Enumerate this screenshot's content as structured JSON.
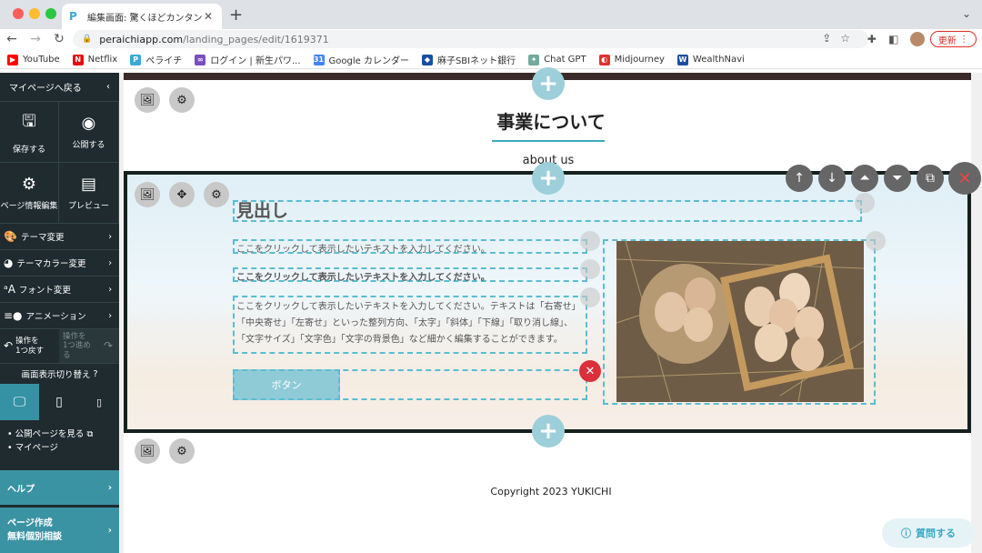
{
  "browser": {
    "tab_title": "編集画面: 驚くほどカンタン！無料",
    "url_host": "peraichiapp.com",
    "url_path": "/landing_pages/edit/1619371",
    "update_label": "更新",
    "bookmarks": [
      {
        "label": "YouTube",
        "color": "#ff0000",
        "glyph": "▶"
      },
      {
        "label": "Netflix",
        "color": "#e50914",
        "glyph": "N"
      },
      {
        "label": "ペライチ",
        "color": "#3aa9d5",
        "glyph": "P"
      },
      {
        "label": "ログイン | 新生パワ...",
        "color": "#7a4fbf",
        "glyph": "∞"
      },
      {
        "label": "Google カレンダー",
        "color": "#4285f4",
        "glyph": "31"
      },
      {
        "label": "麻子SBIネット銀行",
        "color": "#1a4fa0",
        "glyph": "◆"
      },
      {
        "label": "Chat GPT",
        "color": "#74aa9c",
        "glyph": "✦"
      },
      {
        "label": "Midjourney",
        "color": "#d33",
        "glyph": "◐"
      },
      {
        "label": "WealthNavi",
        "color": "#1e4fa2",
        "glyph": "W"
      }
    ]
  },
  "sidebar": {
    "back": "マイページへ戻る",
    "save": "保存する",
    "publish": "公開する",
    "page_info": "ページ情報編集",
    "preview": "プレビュー",
    "theme": "テーマ変更",
    "theme_color": "テーマカラー変更",
    "font": "フォント変更",
    "animation": "アニメーション",
    "undo_line1": "操作を",
    "undo_line2": "1つ戻す",
    "redo_line1": "操作を",
    "redo_line2": "1つ進める",
    "view_switch": "画面表示切り替え",
    "link_public": "公開ページを見る",
    "link_mypage": "マイページ",
    "help": "ヘルプ",
    "consult_line1": "ページ作成",
    "consult_line2": "無料個別相談"
  },
  "page": {
    "heading": "事業について",
    "subheading": "about us",
    "section": {
      "title": "見出し",
      "text1": "ここをクリックして表示したいテキストを入力してください。",
      "text2": "ここをクリックして表示したいテキストを入力してください。",
      "text3": "ここをクリックして表示したいテキストを入力してください。テキストは「右寄せ」「中央寄せ」「左寄せ」といった整列方向、「太字」「斜体」「下線」「取り消し線」、「文字サイズ」「文字色」「文字の背景色」など細かく編集することができます。",
      "button": "ボタン"
    },
    "footer": "Copyright 2023 YUKICHI"
  },
  "help_button": "質問する",
  "colors": {
    "sidebar_bg": "#1f2b2f",
    "accent_teal": "#3a93a3",
    "dashed_border": "#5bbdd0",
    "delete_red": "#d9303a"
  }
}
